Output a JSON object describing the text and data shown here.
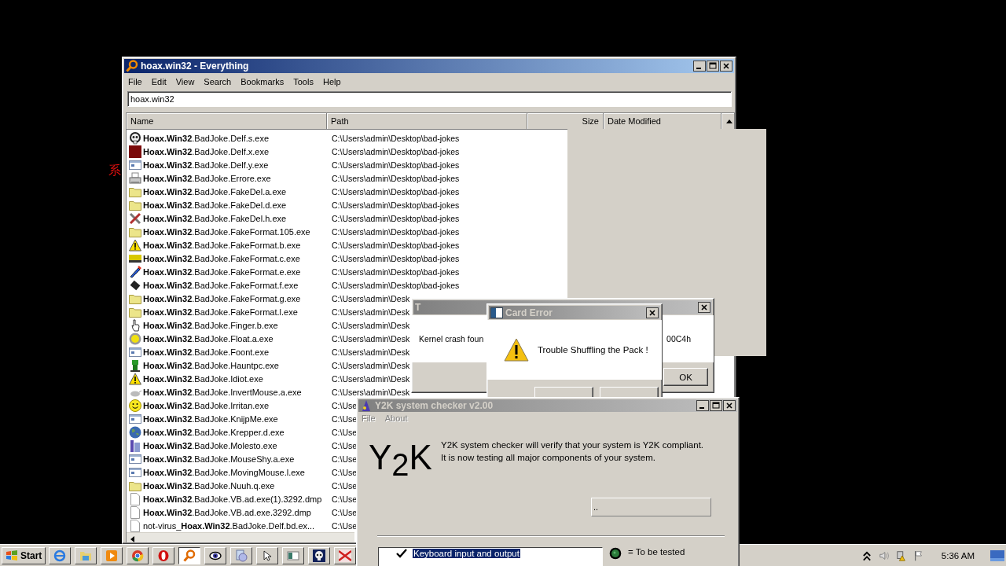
{
  "desktop": {
    "side_text": "系"
  },
  "everything": {
    "title": "hoax.win32 - Everything",
    "active": true,
    "menu": [
      "File",
      "Edit",
      "View",
      "Search",
      "Bookmarks",
      "Tools",
      "Help"
    ],
    "search": {
      "value": "hoax.win32"
    },
    "columns": [
      "Name",
      "Path",
      "Size",
      "Date Modified"
    ],
    "rows": [
      {
        "kind": "skull",
        "name": "**Hoax.Win32**.BadJoke.Delf.s.exe",
        "path": "C:\\Users\\admin\\Desktop\\bad-jokes"
      },
      {
        "kind": "square",
        "name": "**Hoax.Win32**.BadJoke.Delf.x.exe",
        "path": "C:\\Users\\admin\\Desktop\\bad-jokes"
      },
      {
        "kind": "window",
        "name": "**Hoax.Win32**.BadJoke.Delf.y.exe",
        "path": "C:\\Users\\admin\\Desktop\\bad-jokes"
      },
      {
        "kind": "printer",
        "name": "**Hoax.Win32**.BadJoke.Errore.exe",
        "path": "C:\\Users\\admin\\Desktop\\bad-jokes"
      },
      {
        "kind": "folder",
        "name": "**Hoax.Win32**.BadJoke.FakeDel.a.exe",
        "path": "C:\\Users\\admin\\Desktop\\bad-jokes"
      },
      {
        "kind": "folder",
        "name": "**Hoax.Win32**.BadJoke.FakeDel.d.exe",
        "path": "C:\\Users\\admin\\Desktop\\bad-jokes"
      },
      {
        "kind": "tools",
        "name": "**Hoax.Win32**.BadJoke.FakeDel.h.exe",
        "path": "C:\\Users\\admin\\Desktop\\bad-jokes"
      },
      {
        "kind": "folder",
        "name": "**Hoax.Win32**.BadJoke.FakeFormat.105.exe",
        "path": "C:\\Users\\admin\\Desktop\\bad-jokes"
      },
      {
        "kind": "warning",
        "name": "**Hoax.Win32**.BadJoke.FakeFormat.b.exe",
        "path": "C:\\Users\\admin\\Desktop\\bad-jokes"
      },
      {
        "kind": "truck",
        "name": "**Hoax.Win32**.BadJoke.FakeFormat.c.exe",
        "path": "C:\\Users\\admin\\Desktop\\bad-jokes"
      },
      {
        "kind": "pen",
        "name": "**Hoax.Win32**.BadJoke.FakeFormat.e.exe",
        "path": "C:\\Users\\admin\\Desktop\\bad-jokes"
      },
      {
        "kind": "chip",
        "name": "**Hoax.Win32**.BadJoke.FakeFormat.f.exe",
        "path": "C:\\Users\\admin\\Desktop\\bad-jokes"
      },
      {
        "kind": "folder",
        "name": "**Hoax.Win32**.BadJoke.FakeFormat.g.exe",
        "path": "C:\\Users\\admin\\Desk"
      },
      {
        "kind": "folder",
        "name": "**Hoax.Win32**.BadJoke.FakeFormat.l.exe",
        "path": "C:\\Users\\admin\\Desk"
      },
      {
        "kind": "hand",
        "name": "**Hoax.Win32**.BadJoke.Finger.b.exe",
        "path": "C:\\Users\\admin\\Desk"
      },
      {
        "kind": "sun",
        "name": "**Hoax.Win32**.BadJoke.Float.a.exe",
        "path": "C:\\Users\\admin\\Desk"
      },
      {
        "kind": "window",
        "name": "**Hoax.Win32**.BadJoke.Foont.exe",
        "path": "C:\\Users\\admin\\Desk"
      },
      {
        "kind": "figure",
        "name": "**Hoax.Win32**.BadJoke.Hauntpc.exe",
        "path": "C:\\Users\\admin\\Desk"
      },
      {
        "kind": "warning",
        "name": "**Hoax.Win32**.BadJoke.Idiot.exe",
        "path": "C:\\Users\\admin\\Desk"
      },
      {
        "kind": "mouse",
        "name": "**Hoax.Win32**.BadJoke.InvertMouse.a.exe",
        "path": "C:\\Users\\admin\\Desk"
      },
      {
        "kind": "smiley",
        "name": "**Hoax.Win32**.BadJoke.Irritan.exe",
        "path": "C:\\Use"
      },
      {
        "kind": "window",
        "name": "**Hoax.Win32**.BadJoke.KnijpMe.exe",
        "path": "C:\\Use"
      },
      {
        "kind": "globe",
        "name": "**Hoax.Win32**.BadJoke.Krepper.d.exe",
        "path": "C:\\Use"
      },
      {
        "kind": "tower",
        "name": "**Hoax.Win32**.BadJoke.Molesto.exe",
        "path": "C:\\Use"
      },
      {
        "kind": "window",
        "name": "**Hoax.Win32**.BadJoke.MouseShy.a.exe",
        "path": "C:\\Use"
      },
      {
        "kind": "window",
        "name": "**Hoax.Win32**.BadJoke.MovingMouse.l.exe",
        "path": "C:\\Use"
      },
      {
        "kind": "folder",
        "name": "**Hoax.Win32**.BadJoke.Nuuh.q.exe",
        "path": "C:\\Use"
      },
      {
        "kind": "document",
        "name": "**Hoax.Win32**.BadJoke.VB.ad.exe(1).3292.dmp",
        "path": "C:\\Use"
      },
      {
        "kind": "document",
        "name": "**Hoax.Win32**.BadJoke.VB.ad.exe.3292.dmp",
        "path": "C:\\Use"
      },
      {
        "kind": "document",
        "name": "not-virus_**Hoax.Win32**.BadJoke.Delf.bd.ex...",
        "path": "C:\\Use"
      }
    ]
  },
  "crash_dialog": {
    "title": "T",
    "message": "Kernel crash foun",
    "code": "00C4h",
    "button": "OK"
  },
  "card_error": {
    "title": "Card Error",
    "message": "Trouble Shuffling the Pack !"
  },
  "y2k": {
    "title": "Y2K system checker v2.00",
    "active": false,
    "menu": [
      {
        "label": "File",
        "disabled": true
      },
      {
        "label": "About",
        "disabled": true
      }
    ],
    "logo": "Y$_{2}$K",
    "description": [
      "Y2K system checker will verify that your system is Y2K compliant.",
      "It is now testing all major components of your system."
    ],
    "status": "..",
    "items": [
      {
        "label": "Keyboard input and output",
        "checked": true,
        "selected": true
      }
    ],
    "legend": "= To be tested"
  },
  "taskbar": {
    "start": "Start",
    "buttons": [
      {
        "kind": "ie",
        "selected": false
      },
      {
        "kind": "explorer",
        "selected": false
      },
      {
        "kind": "media",
        "selected": false
      },
      {
        "kind": "chrome",
        "selected": false
      },
      {
        "kind": "opera",
        "selected": false
      },
      {
        "kind": "search",
        "selected": true
      },
      {
        "kind": "eye",
        "selected": false
      },
      {
        "kind": "disk",
        "selected": false
      },
      {
        "kind": "cursor",
        "selected": false
      },
      {
        "kind": "window",
        "selected": false
      },
      {
        "kind": "skull",
        "selected": false
      },
      {
        "kind": "red",
        "selected": false
      }
    ],
    "clock": "5:36 AM"
  }
}
